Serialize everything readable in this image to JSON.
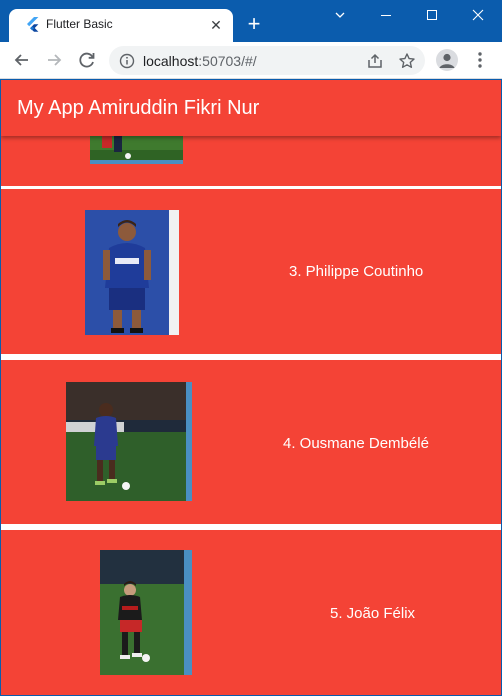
{
  "browser": {
    "tab_title": "Flutter Basic",
    "url_host": "localhost",
    "url_rest": ":50703/#/",
    "colors": {
      "frame": "#0b5cad",
      "toolbar": "#ffffff",
      "omnibox": "#f1f3f4"
    }
  },
  "app": {
    "title": "My App Amiruddin Fikri Nur",
    "accent": "#f44336",
    "players": [
      {
        "label": "3. Philippe Coutinho",
        "photo_icon": "player-photo-icon"
      },
      {
        "label": "4. Ousmane Dembélé",
        "photo_icon": "player-photo-icon"
      },
      {
        "label": "5. João Félix",
        "photo_icon": "player-photo-icon"
      }
    ]
  }
}
